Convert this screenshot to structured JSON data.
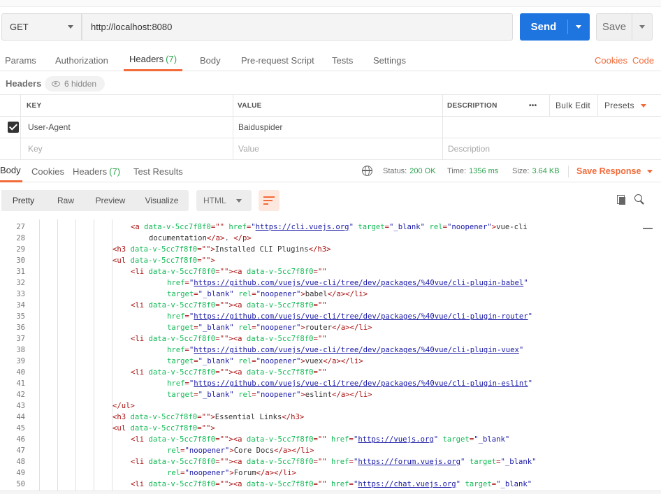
{
  "request": {
    "method": "GET",
    "url": "http://localhost:8080",
    "send_label": "Send",
    "save_label": "Save"
  },
  "request_tabs": [
    {
      "label": "Params"
    },
    {
      "label": "Authorization"
    },
    {
      "label": "Headers",
      "count": "(7)"
    },
    {
      "label": "Body"
    },
    {
      "label": "Pre-request Script"
    },
    {
      "label": "Tests"
    },
    {
      "label": "Settings"
    }
  ],
  "request_links": {
    "cookies": "Cookies",
    "code": "Code"
  },
  "headers_section": {
    "title": "Headers",
    "hidden": "6 hidden"
  },
  "headers_table": {
    "columns": {
      "key": "KEY",
      "value": "VALUE",
      "description": "DESCRIPTION"
    },
    "more": "•••",
    "bulk_edit": "Bulk Edit",
    "presets": "Presets",
    "rows": [
      {
        "key": "User-Agent",
        "value": "Baiduspider",
        "description": ""
      }
    ],
    "placeholders": {
      "key": "Key",
      "value": "Value",
      "description": "Description"
    }
  },
  "response_tabs": [
    {
      "label": "Body"
    },
    {
      "label": "Cookies"
    },
    {
      "label": "Headers",
      "count": "(7)"
    },
    {
      "label": "Test Results"
    }
  ],
  "response_stats": {
    "status_label": "Status:",
    "status": "200 OK",
    "time_label": "Time:",
    "time": "1356 ms",
    "size_label": "Size:",
    "size": "3.64 KB",
    "save_response": "Save Response"
  },
  "viewer": {
    "modes": [
      "Pretty",
      "Raw",
      "Preview",
      "Visualize"
    ],
    "format": "HTML"
  },
  "code_lines": [
    {
      "n": "27",
      "indent": 3,
      "segs": [
        [
          "t",
          "<a "
        ],
        [
          "at",
          "data-v-5cc7f8f0"
        ],
        [
          "t",
          "=\"\" "
        ],
        [
          "at",
          "href"
        ],
        [
          "t",
          "="
        ],
        [
          "av",
          "\""
        ],
        [
          "u",
          "https://cli.vuejs.org"
        ],
        [
          "av",
          "\""
        ],
        [
          "t",
          " "
        ],
        [
          "at",
          "target"
        ],
        [
          "t",
          "="
        ],
        [
          "av",
          "\"_blank\""
        ],
        [
          "t",
          " "
        ],
        [
          "at",
          "rel"
        ],
        [
          "t",
          "="
        ],
        [
          "av",
          "\"noopener\""
        ],
        [
          "t",
          ">"
        ],
        [
          "x",
          "vue-cli"
        ]
      ]
    },
    {
      "n": "28",
      "indent": 4,
      "segs": [
        [
          "x",
          "documentation"
        ],
        [
          "t",
          "</a>"
        ],
        [
          "x",
          ". "
        ],
        [
          "t",
          "</p>"
        ]
      ]
    },
    {
      "n": "29",
      "indent": 2,
      "segs": [
        [
          "t",
          "<h3 "
        ],
        [
          "at",
          "data-v-5cc7f8f0"
        ],
        [
          "t",
          "=\"\">"
        ],
        [
          "x",
          "Installed CLI Plugins"
        ],
        [
          "t",
          "</h3>"
        ]
      ]
    },
    {
      "n": "30",
      "indent": 2,
      "segs": [
        [
          "t",
          "<ul "
        ],
        [
          "at",
          "data-v-5cc7f8f0"
        ],
        [
          "t",
          "=\"\">"
        ]
      ]
    },
    {
      "n": "31",
      "indent": 3,
      "segs": [
        [
          "t",
          "<li "
        ],
        [
          "at",
          "data-v-5cc7f8f0"
        ],
        [
          "t",
          "=\"\"><a "
        ],
        [
          "at",
          "data-v-5cc7f8f0"
        ],
        [
          "t",
          "=\"\""
        ]
      ]
    },
    {
      "n": "32",
      "indent": 5,
      "segs": [
        [
          "at",
          "href"
        ],
        [
          "t",
          "="
        ],
        [
          "av",
          "\""
        ],
        [
          "u",
          "https://github.com/vuejs/vue-cli/tree/dev/packages/%40vue/cli-plugin-babel"
        ],
        [
          "av",
          "\""
        ]
      ]
    },
    {
      "n": "33",
      "indent": 5,
      "segs": [
        [
          "at",
          "target"
        ],
        [
          "t",
          "="
        ],
        [
          "av",
          "\"_blank\""
        ],
        [
          "t",
          " "
        ],
        [
          "at",
          "rel"
        ],
        [
          "t",
          "="
        ],
        [
          "av",
          "\"noopener\""
        ],
        [
          "t",
          ">"
        ],
        [
          "x",
          "babel"
        ],
        [
          "t",
          "</a></li>"
        ]
      ]
    },
    {
      "n": "34",
      "indent": 3,
      "segs": [
        [
          "t",
          "<li "
        ],
        [
          "at",
          "data-v-5cc7f8f0"
        ],
        [
          "t",
          "=\"\"><a "
        ],
        [
          "at",
          "data-v-5cc7f8f0"
        ],
        [
          "t",
          "=\"\""
        ]
      ]
    },
    {
      "n": "35",
      "indent": 5,
      "segs": [
        [
          "at",
          "href"
        ],
        [
          "t",
          "="
        ],
        [
          "av",
          "\""
        ],
        [
          "u",
          "https://github.com/vuejs/vue-cli/tree/dev/packages/%40vue/cli-plugin-router"
        ],
        [
          "av",
          "\""
        ]
      ]
    },
    {
      "n": "36",
      "indent": 5,
      "segs": [
        [
          "at",
          "target"
        ],
        [
          "t",
          "="
        ],
        [
          "av",
          "\"_blank\""
        ],
        [
          "t",
          " "
        ],
        [
          "at",
          "rel"
        ],
        [
          "t",
          "="
        ],
        [
          "av",
          "\"noopener\""
        ],
        [
          "t",
          ">"
        ],
        [
          "x",
          "router"
        ],
        [
          "t",
          "</a></li>"
        ]
      ]
    },
    {
      "n": "37",
      "indent": 3,
      "segs": [
        [
          "t",
          "<li "
        ],
        [
          "at",
          "data-v-5cc7f8f0"
        ],
        [
          "t",
          "=\"\"><a "
        ],
        [
          "at",
          "data-v-5cc7f8f0"
        ],
        [
          "t",
          "=\"\""
        ]
      ]
    },
    {
      "n": "38",
      "indent": 5,
      "segs": [
        [
          "at",
          "href"
        ],
        [
          "t",
          "="
        ],
        [
          "av",
          "\""
        ],
        [
          "u",
          "https://github.com/vuejs/vue-cli/tree/dev/packages/%40vue/cli-plugin-vuex"
        ],
        [
          "av",
          "\""
        ]
      ]
    },
    {
      "n": "39",
      "indent": 5,
      "segs": [
        [
          "at",
          "target"
        ],
        [
          "t",
          "="
        ],
        [
          "av",
          "\"_blank\""
        ],
        [
          "t",
          " "
        ],
        [
          "at",
          "rel"
        ],
        [
          "t",
          "="
        ],
        [
          "av",
          "\"noopener\""
        ],
        [
          "t",
          ">"
        ],
        [
          "x",
          "vuex"
        ],
        [
          "t",
          "</a></li>"
        ]
      ]
    },
    {
      "n": "40",
      "indent": 3,
      "segs": [
        [
          "t",
          "<li "
        ],
        [
          "at",
          "data-v-5cc7f8f0"
        ],
        [
          "t",
          "=\"\"><a "
        ],
        [
          "at",
          "data-v-5cc7f8f0"
        ],
        [
          "t",
          "=\"\""
        ]
      ]
    },
    {
      "n": "41",
      "indent": 5,
      "segs": [
        [
          "at",
          "href"
        ],
        [
          "t",
          "="
        ],
        [
          "av",
          "\""
        ],
        [
          "u",
          "https://github.com/vuejs/vue-cli/tree/dev/packages/%40vue/cli-plugin-eslint"
        ],
        [
          "av",
          "\""
        ]
      ]
    },
    {
      "n": "42",
      "indent": 5,
      "segs": [
        [
          "at",
          "target"
        ],
        [
          "t",
          "="
        ],
        [
          "av",
          "\"_blank\""
        ],
        [
          "t",
          " "
        ],
        [
          "at",
          "rel"
        ],
        [
          "t",
          "="
        ],
        [
          "av",
          "\"noopener\""
        ],
        [
          "t",
          ">"
        ],
        [
          "x",
          "eslint"
        ],
        [
          "t",
          "</a></li>"
        ]
      ]
    },
    {
      "n": "43",
      "indent": 2,
      "segs": [
        [
          "t",
          "</ul>"
        ]
      ]
    },
    {
      "n": "44",
      "indent": 2,
      "segs": [
        [
          "t",
          "<h3 "
        ],
        [
          "at",
          "data-v-5cc7f8f0"
        ],
        [
          "t",
          "=\"\">"
        ],
        [
          "x",
          "Essential Links"
        ],
        [
          "t",
          "</h3>"
        ]
      ]
    },
    {
      "n": "45",
      "indent": 2,
      "segs": [
        [
          "t",
          "<ul "
        ],
        [
          "at",
          "data-v-5cc7f8f0"
        ],
        [
          "t",
          "=\"\">"
        ]
      ]
    },
    {
      "n": "46",
      "indent": 3,
      "segs": [
        [
          "t",
          "<li "
        ],
        [
          "at",
          "data-v-5cc7f8f0"
        ],
        [
          "t",
          "=\"\"><a "
        ],
        [
          "at",
          "data-v-5cc7f8f0"
        ],
        [
          "t",
          "=\"\" "
        ],
        [
          "at",
          "href"
        ],
        [
          "t",
          "="
        ],
        [
          "av",
          "\""
        ],
        [
          "u",
          "https://vuejs.org"
        ],
        [
          "av",
          "\""
        ],
        [
          "t",
          " "
        ],
        [
          "at",
          "target"
        ],
        [
          "t",
          "="
        ],
        [
          "av",
          "\"_blank\""
        ]
      ]
    },
    {
      "n": "47",
      "indent": 5,
      "segs": [
        [
          "at",
          "rel"
        ],
        [
          "t",
          "="
        ],
        [
          "av",
          "\"noopener\""
        ],
        [
          "t",
          ">"
        ],
        [
          "x",
          "Core Docs"
        ],
        [
          "t",
          "</a></li>"
        ]
      ]
    },
    {
      "n": "48",
      "indent": 3,
      "segs": [
        [
          "t",
          "<li "
        ],
        [
          "at",
          "data-v-5cc7f8f0"
        ],
        [
          "t",
          "=\"\"><a "
        ],
        [
          "at",
          "data-v-5cc7f8f0"
        ],
        [
          "t",
          "=\"\" "
        ],
        [
          "at",
          "href"
        ],
        [
          "t",
          "="
        ],
        [
          "av",
          "\""
        ],
        [
          "u",
          "https://forum.vuejs.org"
        ],
        [
          "av",
          "\""
        ],
        [
          "t",
          " "
        ],
        [
          "at",
          "target"
        ],
        [
          "t",
          "="
        ],
        [
          "av",
          "\"_blank\""
        ]
      ]
    },
    {
      "n": "49",
      "indent": 5,
      "segs": [
        [
          "at",
          "rel"
        ],
        [
          "t",
          "="
        ],
        [
          "av",
          "\"noopener\""
        ],
        [
          "t",
          ">"
        ],
        [
          "x",
          "Forum"
        ],
        [
          "t",
          "</a></li>"
        ]
      ]
    },
    {
      "n": "50",
      "indent": 3,
      "segs": [
        [
          "t",
          "<li "
        ],
        [
          "at",
          "data-v-5cc7f8f0"
        ],
        [
          "t",
          "=\"\"><a "
        ],
        [
          "at",
          "data-v-5cc7f8f0"
        ],
        [
          "t",
          "=\"\" "
        ],
        [
          "at",
          "href"
        ],
        [
          "t",
          "="
        ],
        [
          "av",
          "\""
        ],
        [
          "u",
          "https://chat.vuejs.org"
        ],
        [
          "av",
          "\""
        ],
        [
          "t",
          " "
        ],
        [
          "at",
          "target"
        ],
        [
          "t",
          "="
        ],
        [
          "av",
          "\"_blank\""
        ]
      ]
    }
  ],
  "colors": {
    "accent": "#f26b3a",
    "send": "#1f75e0",
    "success": "#2ea44f"
  }
}
